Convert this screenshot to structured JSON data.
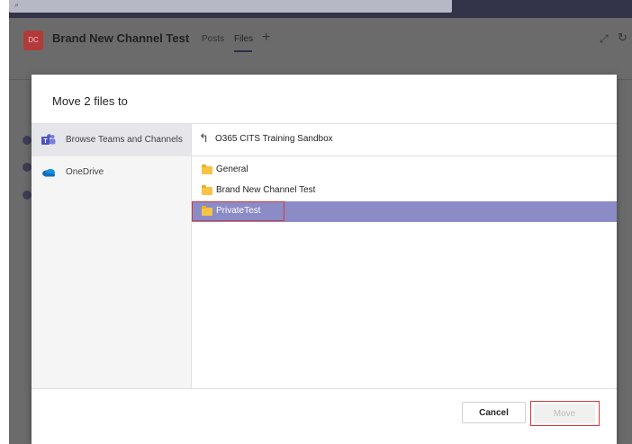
{
  "titlebar": {
    "search_glyph": "Q Search"
  },
  "channel": {
    "avatar_initials": "DC",
    "name": "Brand New Channel Test",
    "tabs": [
      {
        "label": "Posts"
      },
      {
        "label": "Files"
      }
    ],
    "add_tab": "+"
  },
  "dialog": {
    "title": "Move 2 files to",
    "sources": [
      {
        "label": "Browse Teams and Channels",
        "icon": "teams-icon",
        "selected": true
      },
      {
        "label": "OneDrive",
        "icon": "onedrive-icon",
        "selected": false
      }
    ],
    "breadcrumb": "O365 CITS Training Sandbox",
    "folders": [
      {
        "name": "General",
        "selected": false
      },
      {
        "name": "Brand New Channel Test",
        "selected": false
      },
      {
        "name": "PrivateTest",
        "selected": true
      }
    ],
    "cancel_label": "Cancel",
    "move_label": "Move"
  },
  "colors": {
    "selection": "#8b8cc7",
    "highlight": "#d33a3a",
    "folder": "#f6c343",
    "teams": "#5b5fc7",
    "onedrive": "#0f6cbd"
  }
}
